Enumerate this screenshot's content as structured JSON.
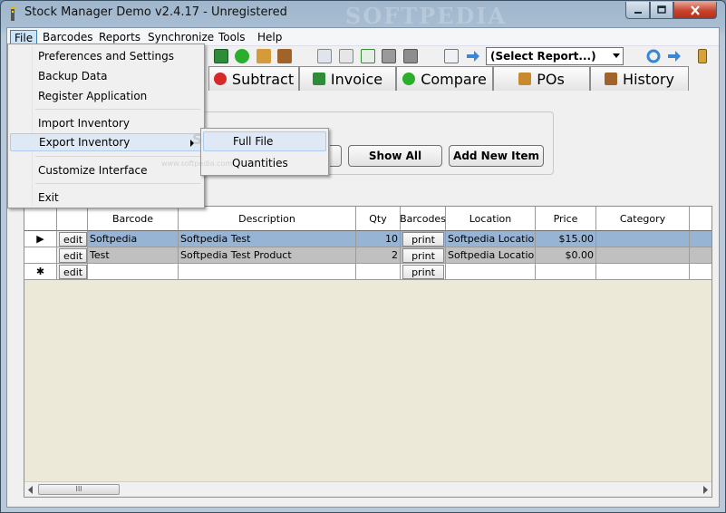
{
  "window": {
    "title": "Stock Manager Demo v2.4.17 - Unregistered",
    "watermark": "SOFTPEDIA",
    "watermark_small": "www.softpedia.com"
  },
  "menubar": {
    "items": [
      "File",
      "Barcodes",
      "Reports",
      "Synchronize",
      "Tools",
      "Help"
    ]
  },
  "toolbar": {
    "report_select": "(Select Report...)"
  },
  "tabs": [
    {
      "label": "Subtract",
      "icon": "stop-icon",
      "color": "#d62a2a"
    },
    {
      "label": "Invoice",
      "icon": "invoice-icon",
      "color": "#2f8d3a"
    },
    {
      "label": "Compare",
      "icon": "check-icon",
      "color": "#2bae2b"
    },
    {
      "label": "POs",
      "icon": "box-icon",
      "color": "#c98a2e"
    },
    {
      "label": "History",
      "icon": "cabinet-icon",
      "color": "#a0642a"
    }
  ],
  "search": {
    "show_all": "Show All",
    "add_new_item": "Add New Item"
  },
  "grid": {
    "columns": [
      "Barcode",
      "Description",
      "Qty",
      "Barcodes",
      "Location",
      "Price",
      "Category"
    ],
    "edit_label": "edit",
    "print_label": "print",
    "rows": [
      {
        "marker": "▶",
        "barcode": "Softpedia",
        "description": "Softpedia Test",
        "qty": "10",
        "location": "Softpedia Location",
        "price": "$15.00",
        "category": ""
      },
      {
        "marker": "",
        "barcode": "Test",
        "description": "Softpedia Test Product",
        "qty": "2",
        "location": "Softpedia Location",
        "price": "$0.00",
        "category": ""
      },
      {
        "marker": "✱",
        "barcode": "",
        "description": "",
        "qty": "",
        "location": "",
        "price": "",
        "category": ""
      }
    ],
    "scroll_thumb": "III"
  },
  "file_menu": {
    "items": [
      "Preferences and Settings",
      "Backup Data",
      "Register Application",
      "Import Inventory",
      "Export Inventory",
      "Customize Interface",
      "Exit"
    ]
  },
  "export_submenu": {
    "items": [
      "Full File",
      "Quantities"
    ]
  }
}
